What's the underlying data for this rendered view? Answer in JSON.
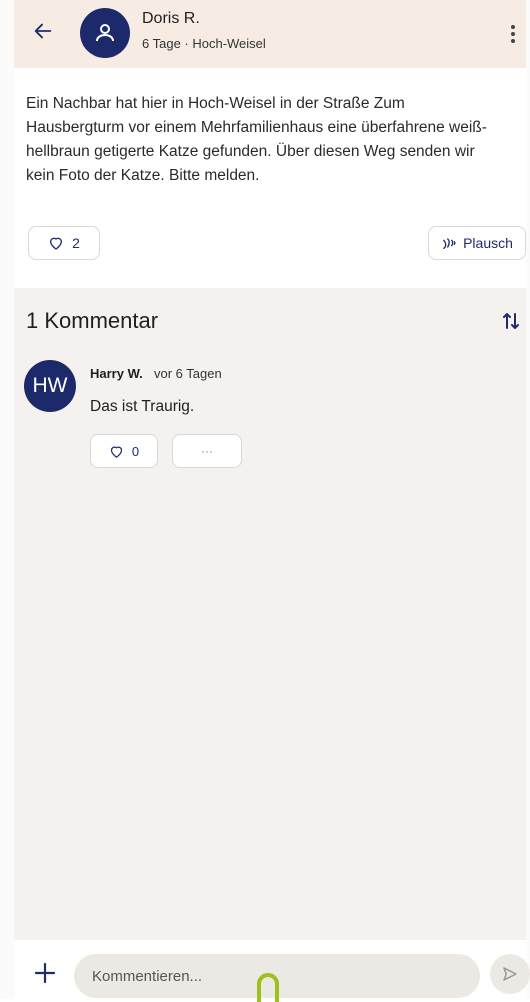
{
  "post": {
    "author": "Doris R.",
    "meta": "6 Tage · Hoch-Weisel",
    "text": "Ein Nachbar hat hier in Hoch-Weisel in der Straße Zum Hausbergturm vor einem Mehrfamilienhaus eine überfahrene weiß-hellbraun getigerte Katze gefunden. Über diesen Weg senden wir kein Foto der Katze. Bitte melden.",
    "likes": "2",
    "plausch_label": "Plausch"
  },
  "comments": {
    "title": "1 Kommentar",
    "items": [
      {
        "initials": "HW",
        "author": "Harry W.",
        "time": "vor 6 Tagen",
        "text": "Das ist Traurig.",
        "likes": "0",
        "more_label": "···"
      }
    ]
  },
  "composer": {
    "placeholder": "Kommentieren..."
  },
  "colors": {
    "header_bg": "#f7ece4",
    "accent": "#1c2a6b",
    "comments_bg": "#f5f1ee",
    "cursor_handle": "#9bc21a"
  },
  "icons": [
    "back-arrow-icon",
    "user-icon",
    "more-vertical-icon",
    "heart-icon",
    "plausch-icon",
    "sort-icon",
    "plus-icon",
    "send-icon"
  ]
}
